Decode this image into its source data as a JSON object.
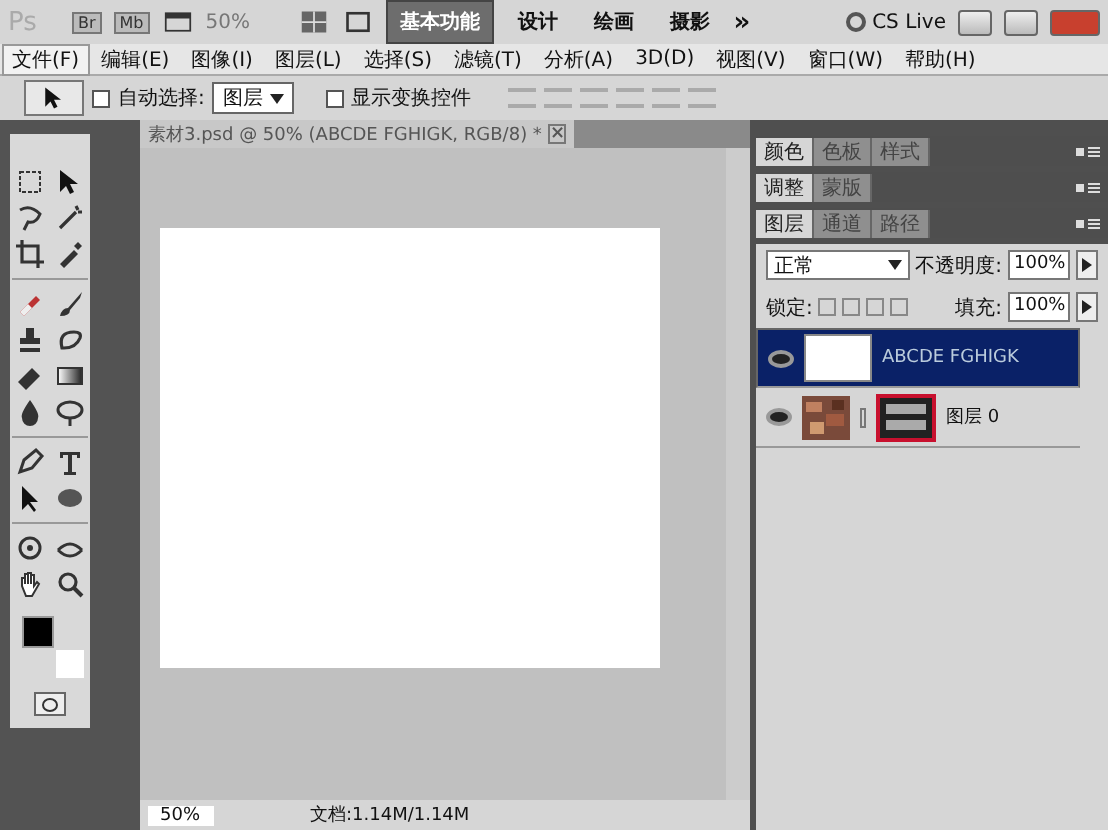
{
  "app_bar": {
    "logo": "Ps",
    "bridge": "Br",
    "mini_bridge": "Mb",
    "zoom": "50%",
    "workspaces": [
      {
        "label": "基本功能",
        "selected": true
      },
      {
        "label": "设计",
        "selected": false
      },
      {
        "label": "绘画",
        "selected": false
      },
      {
        "label": "摄影",
        "selected": false
      }
    ],
    "more": "»",
    "cs_live": "CS Live"
  },
  "menu": [
    {
      "label": "文件(F)",
      "selected": true
    },
    {
      "label": "编辑(E)",
      "selected": false
    },
    {
      "label": "图像(I)",
      "selected": false
    },
    {
      "label": "图层(L)",
      "selected": false
    },
    {
      "label": "选择(S)",
      "selected": false
    },
    {
      "label": "滤镜(T)",
      "selected": false
    },
    {
      "label": "分析(A)",
      "selected": false
    },
    {
      "label": "3D(D)",
      "selected": false
    },
    {
      "label": "视图(V)",
      "selected": false
    },
    {
      "label": "窗口(W)",
      "selected": false
    },
    {
      "label": "帮助(H)",
      "selected": false
    }
  ],
  "options": {
    "auto_select": {
      "label": "自动选择:",
      "checked": false
    },
    "auto_select_value": "图层",
    "transform": {
      "label": "显示变换控件",
      "checked": false
    }
  },
  "document": {
    "tab": "素材3.psd @ 50% (ABCDE FGHIGK, RGB/8) *",
    "close": "×"
  },
  "status_bar": {
    "zoom": "50%",
    "doc_size": "文档:1.14M/1.14M"
  },
  "panels": [
    {
      "tabs": [
        {
          "label": "颜色",
          "selected": true
        },
        {
          "label": "色板",
          "selected": false
        },
        {
          "label": "样式",
          "selected": false
        }
      ]
    },
    {
      "tabs": [
        {
          "label": "调整",
          "selected": true
        },
        {
          "label": "蒙版",
          "selected": false
        }
      ]
    },
    {
      "tabs": [
        {
          "label": "图层",
          "selected": true
        },
        {
          "label": "通道",
          "selected": false
        },
        {
          "label": "路径",
          "selected": false
        }
      ]
    }
  ],
  "layers_panel": {
    "blend_mode": "正常",
    "opacity_label": "不透明度:",
    "opacity": "100%",
    "lock_label": "锁定:",
    "fill_label": "填充:",
    "fill": "100%",
    "layers": [
      {
        "name": "ABCDE FGHIGK",
        "kind": "text",
        "selected": true,
        "visible": true
      },
      {
        "name": "图层 0",
        "kind": "masked",
        "selected": false,
        "visible": true
      }
    ]
  }
}
